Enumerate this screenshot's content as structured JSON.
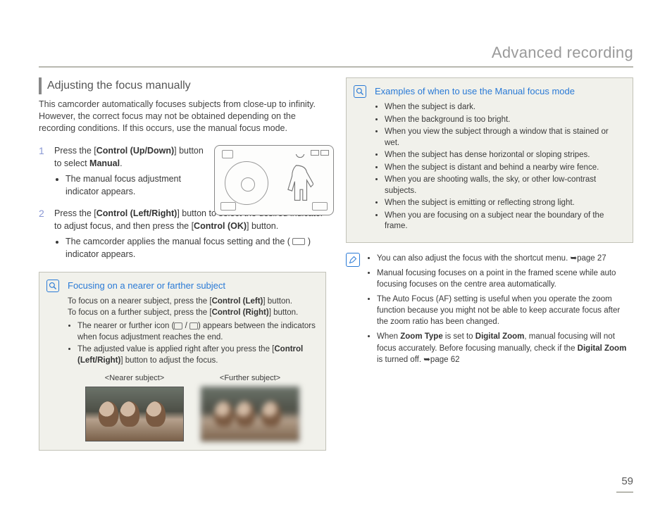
{
  "chapter": "Advanced recording",
  "section_heading": "Adjusting the focus manually",
  "intro": "This camcorder automatically focuses subjects from close-up to infinity. However, the correct focus may not be obtained depending on the recording conditions. If this occurs, use the manual focus mode.",
  "steps": [
    {
      "num": "1",
      "text_parts": {
        "a": "Press the [",
        "b": "Control (Up/Down)",
        "c": "] button to select ",
        "d": "Manual",
        "e": "."
      },
      "bullets": [
        "The manual focus adjustment indicator appears."
      ]
    },
    {
      "num": "2",
      "text_parts": {
        "a": "Press the [",
        "b": "Control (Left/Right)",
        "c": "] button to select the desired indicator to adjust focus, and then press the [",
        "d": "Control (OK)",
        "e": "] button."
      },
      "bullets_parts": {
        "a": "The camcorder applies the manual focus setting and the (",
        "b": ") indicator appears."
      }
    }
  ],
  "callout_left": {
    "title": "Focusing on a nearer or farther subject",
    "line1_parts": {
      "a": "To focus on a nearer subject, press the [",
      "b": "Control (Left)",
      "c": "] button."
    },
    "line2_parts": {
      "a": "To focus on a further subject, press the [",
      "b": "Control (Right)",
      "c": "] button."
    },
    "bullets": [
      {
        "a": "The nearer or further icon (",
        "b": " / ",
        "c": ") appears between the indicators when focus adjustment reaches the end."
      },
      {
        "a": "The adjusted value is applied right after you press the [",
        "b": "Control (Left/Right)",
        "c": "] button to adjust the focus."
      }
    ],
    "thumb_labels": [
      "<Nearer subject>",
      "<Further subject>"
    ]
  },
  "callout_right": {
    "title": "Examples of when to use the Manual focus mode",
    "bullets": [
      "When the subject is dark.",
      "When the background is too bright.",
      "When you view the subject through a window that is stained or wet.",
      "When the subject has dense horizontal or sloping stripes.",
      "When the subject is distant and behind a nearby wire fence.",
      "When you are shooting walls, the sky, or other low-contrast subjects.",
      "When the subject is emitting or reflecting strong light.",
      "When you are focusing on a subject near the boundary of the frame."
    ]
  },
  "note": {
    "items": [
      {
        "a": "You can also adjust the focus with the shortcut menu. ",
        "arrow": "➥",
        "b": "page 27"
      },
      {
        "a": "Manual focusing focuses on a point in the framed scene while auto focusing focuses on the centre area automatically."
      },
      {
        "a": "The Auto Focus (AF) setting is useful when you operate the zoom function because you might not be able to keep accurate focus after the zoom ratio has been changed."
      },
      {
        "a": "When ",
        "b1": "Zoom Type",
        "c": " is set to ",
        "b2": "Digital Zoom",
        "d": ", manual focusing will not focus accurately. Before focusing manually, check if the ",
        "b3": "Digital Zoom",
        "e": " is turned off. ",
        "arrow": "➥",
        "f": "page 62"
      }
    ]
  },
  "page_number": "59"
}
